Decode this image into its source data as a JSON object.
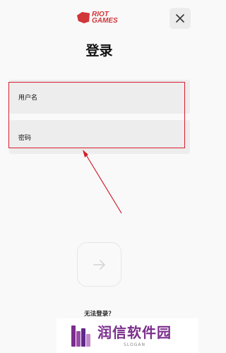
{
  "header": {
    "logo_text_line1": "RIOT",
    "logo_text_line2": "GAMES",
    "close_icon": "close-icon"
  },
  "page": {
    "title": "登录"
  },
  "form": {
    "username_label": "用户名",
    "password_label": "密码",
    "submit_icon": "arrow-right-icon"
  },
  "footer": {
    "cant_login": "无法登录？"
  },
  "watermark": {
    "title": "润信软件园",
    "slogan": "SLOGAN"
  },
  "colors": {
    "brand_red": "#d13639",
    "annotation_red": "#d41e2f",
    "watermark_purple": "#7b2e8c"
  }
}
